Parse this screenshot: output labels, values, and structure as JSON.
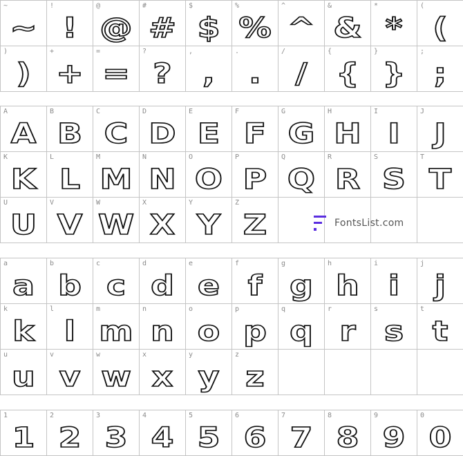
{
  "sections": [
    {
      "cells": [
        {
          "label": "~",
          "glyph": "~"
        },
        {
          "label": "!",
          "glyph": "!"
        },
        {
          "label": "@",
          "glyph": "@"
        },
        {
          "label": "#",
          "glyph": "#"
        },
        {
          "label": "$",
          "glyph": "$"
        },
        {
          "label": "%",
          "glyph": "%"
        },
        {
          "label": "^",
          "glyph": "^"
        },
        {
          "label": "&",
          "glyph": "&"
        },
        {
          "label": "*",
          "glyph": "*"
        },
        {
          "label": "(",
          "glyph": "("
        },
        {
          "label": ")",
          "glyph": ")"
        },
        {
          "label": "+",
          "glyph": "+"
        },
        {
          "label": "=",
          "glyph": "="
        },
        {
          "label": "?",
          "glyph": "?"
        },
        {
          "label": ",",
          "glyph": ","
        },
        {
          "label": ".",
          "glyph": "."
        },
        {
          "label": "/",
          "glyph": "/"
        },
        {
          "label": "{",
          "glyph": "{"
        },
        {
          "label": "}",
          "glyph": "}"
        },
        {
          "label": ";",
          "glyph": ";"
        }
      ]
    },
    {
      "cells": [
        {
          "label": "A",
          "glyph": "A"
        },
        {
          "label": "B",
          "glyph": "B"
        },
        {
          "label": "C",
          "glyph": "C"
        },
        {
          "label": "D",
          "glyph": "D"
        },
        {
          "label": "E",
          "glyph": "E"
        },
        {
          "label": "F",
          "glyph": "F"
        },
        {
          "label": "G",
          "glyph": "G"
        },
        {
          "label": "H",
          "glyph": "H"
        },
        {
          "label": "I",
          "glyph": "I"
        },
        {
          "label": "J",
          "glyph": "J"
        },
        {
          "label": "K",
          "glyph": "K"
        },
        {
          "label": "L",
          "glyph": "L"
        },
        {
          "label": "M",
          "glyph": "M"
        },
        {
          "label": "N",
          "glyph": "N"
        },
        {
          "label": "O",
          "glyph": "O"
        },
        {
          "label": "P",
          "glyph": "P"
        },
        {
          "label": "Q",
          "glyph": "Q"
        },
        {
          "label": "R",
          "glyph": "R"
        },
        {
          "label": "S",
          "glyph": "S"
        },
        {
          "label": "T",
          "glyph": "T"
        },
        {
          "label": "U",
          "glyph": "U"
        },
        {
          "label": "V",
          "glyph": "V"
        },
        {
          "label": "W",
          "glyph": "W"
        },
        {
          "label": "X",
          "glyph": "X"
        },
        {
          "label": "Y",
          "glyph": "Y"
        },
        {
          "label": "Z",
          "glyph": "Z"
        },
        {
          "label": "",
          "glyph": ""
        },
        {
          "label": "",
          "glyph": ""
        },
        {
          "label": "",
          "glyph": ""
        },
        {
          "label": "",
          "glyph": ""
        }
      ]
    },
    {
      "cells": [
        {
          "label": "a",
          "glyph": "a"
        },
        {
          "label": "b",
          "glyph": "b"
        },
        {
          "label": "c",
          "glyph": "c"
        },
        {
          "label": "d",
          "glyph": "d"
        },
        {
          "label": "e",
          "glyph": "e"
        },
        {
          "label": "f",
          "glyph": "f"
        },
        {
          "label": "g",
          "glyph": "g"
        },
        {
          "label": "h",
          "glyph": "h"
        },
        {
          "label": "i",
          "glyph": "i"
        },
        {
          "label": "j",
          "glyph": "j"
        },
        {
          "label": "k",
          "glyph": "k"
        },
        {
          "label": "l",
          "glyph": "l"
        },
        {
          "label": "m",
          "glyph": "m"
        },
        {
          "label": "n",
          "glyph": "n"
        },
        {
          "label": "o",
          "glyph": "o"
        },
        {
          "label": "p",
          "glyph": "p"
        },
        {
          "label": "q",
          "glyph": "q"
        },
        {
          "label": "r",
          "glyph": "r"
        },
        {
          "label": "s",
          "glyph": "s"
        },
        {
          "label": "t",
          "glyph": "t"
        },
        {
          "label": "u",
          "glyph": "u"
        },
        {
          "label": "v",
          "glyph": "v"
        },
        {
          "label": "w",
          "glyph": "w"
        },
        {
          "label": "x",
          "glyph": "x"
        },
        {
          "label": "y",
          "glyph": "y"
        },
        {
          "label": "z",
          "glyph": "z"
        },
        {
          "label": "",
          "glyph": ""
        },
        {
          "label": "",
          "glyph": ""
        },
        {
          "label": "",
          "glyph": ""
        },
        {
          "label": "",
          "glyph": ""
        }
      ]
    },
    {
      "cells": [
        {
          "label": "1",
          "glyph": "1"
        },
        {
          "label": "2",
          "glyph": "2"
        },
        {
          "label": "3",
          "glyph": "3"
        },
        {
          "label": "4",
          "glyph": "4"
        },
        {
          "label": "5",
          "glyph": "5"
        },
        {
          "label": "6",
          "glyph": "6"
        },
        {
          "label": "7",
          "glyph": "7"
        },
        {
          "label": "8",
          "glyph": "8"
        },
        {
          "label": "9",
          "glyph": "9"
        },
        {
          "label": "0",
          "glyph": "0"
        }
      ]
    }
  ],
  "watermark": {
    "text": "FontsList.com",
    "color": "#5b2ee0"
  }
}
